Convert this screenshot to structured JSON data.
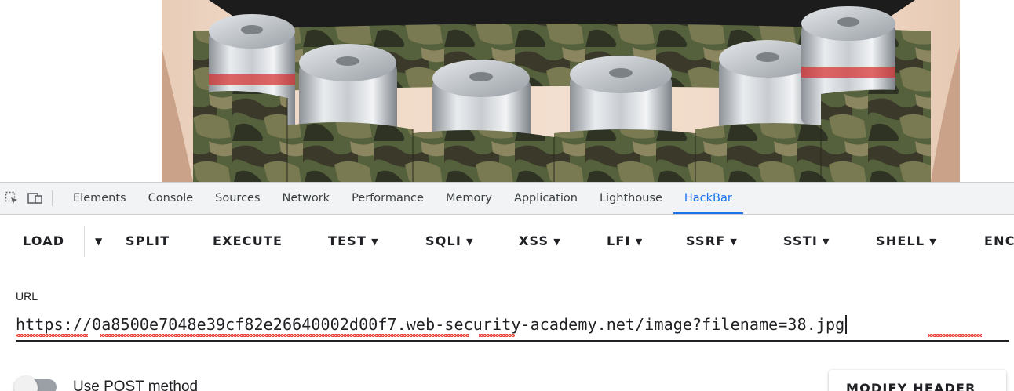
{
  "image": {
    "alt": "Beer belt with six aluminum cans in camouflage pockets"
  },
  "devtools": {
    "tools": [
      {
        "name": "inspect-element-icon"
      },
      {
        "name": "device-toolbar-icon"
      }
    ],
    "tabs": [
      {
        "label": "Elements"
      },
      {
        "label": "Console"
      },
      {
        "label": "Sources"
      },
      {
        "label": "Network"
      },
      {
        "label": "Performance"
      },
      {
        "label": "Memory"
      },
      {
        "label": "Application"
      },
      {
        "label": "Lighthouse"
      },
      {
        "label": "HackBar",
        "active": true
      }
    ],
    "active_color": "#1a73e8"
  },
  "hackbar": {
    "toolbar": {
      "load": "LOAD",
      "load_menu": "▼",
      "split": "SPLIT",
      "execute": "EXECUTE",
      "test": "TEST",
      "sqli": "SQLI",
      "xss": "XSS",
      "lfi": "LFI",
      "ssrf": "SSRF",
      "ssti": "SSTI",
      "shell": "SHELL",
      "encoding": "ENC",
      "caret": "▼"
    },
    "url_label": "URL",
    "url_value": "https://0a8500e7048e39cf82e26640002d00f7.web-security-academy.net/image?filename=38.jpg",
    "post_label": "Use POST method",
    "post_enabled": false,
    "modify_header_label": "MODIFY HEADER"
  }
}
